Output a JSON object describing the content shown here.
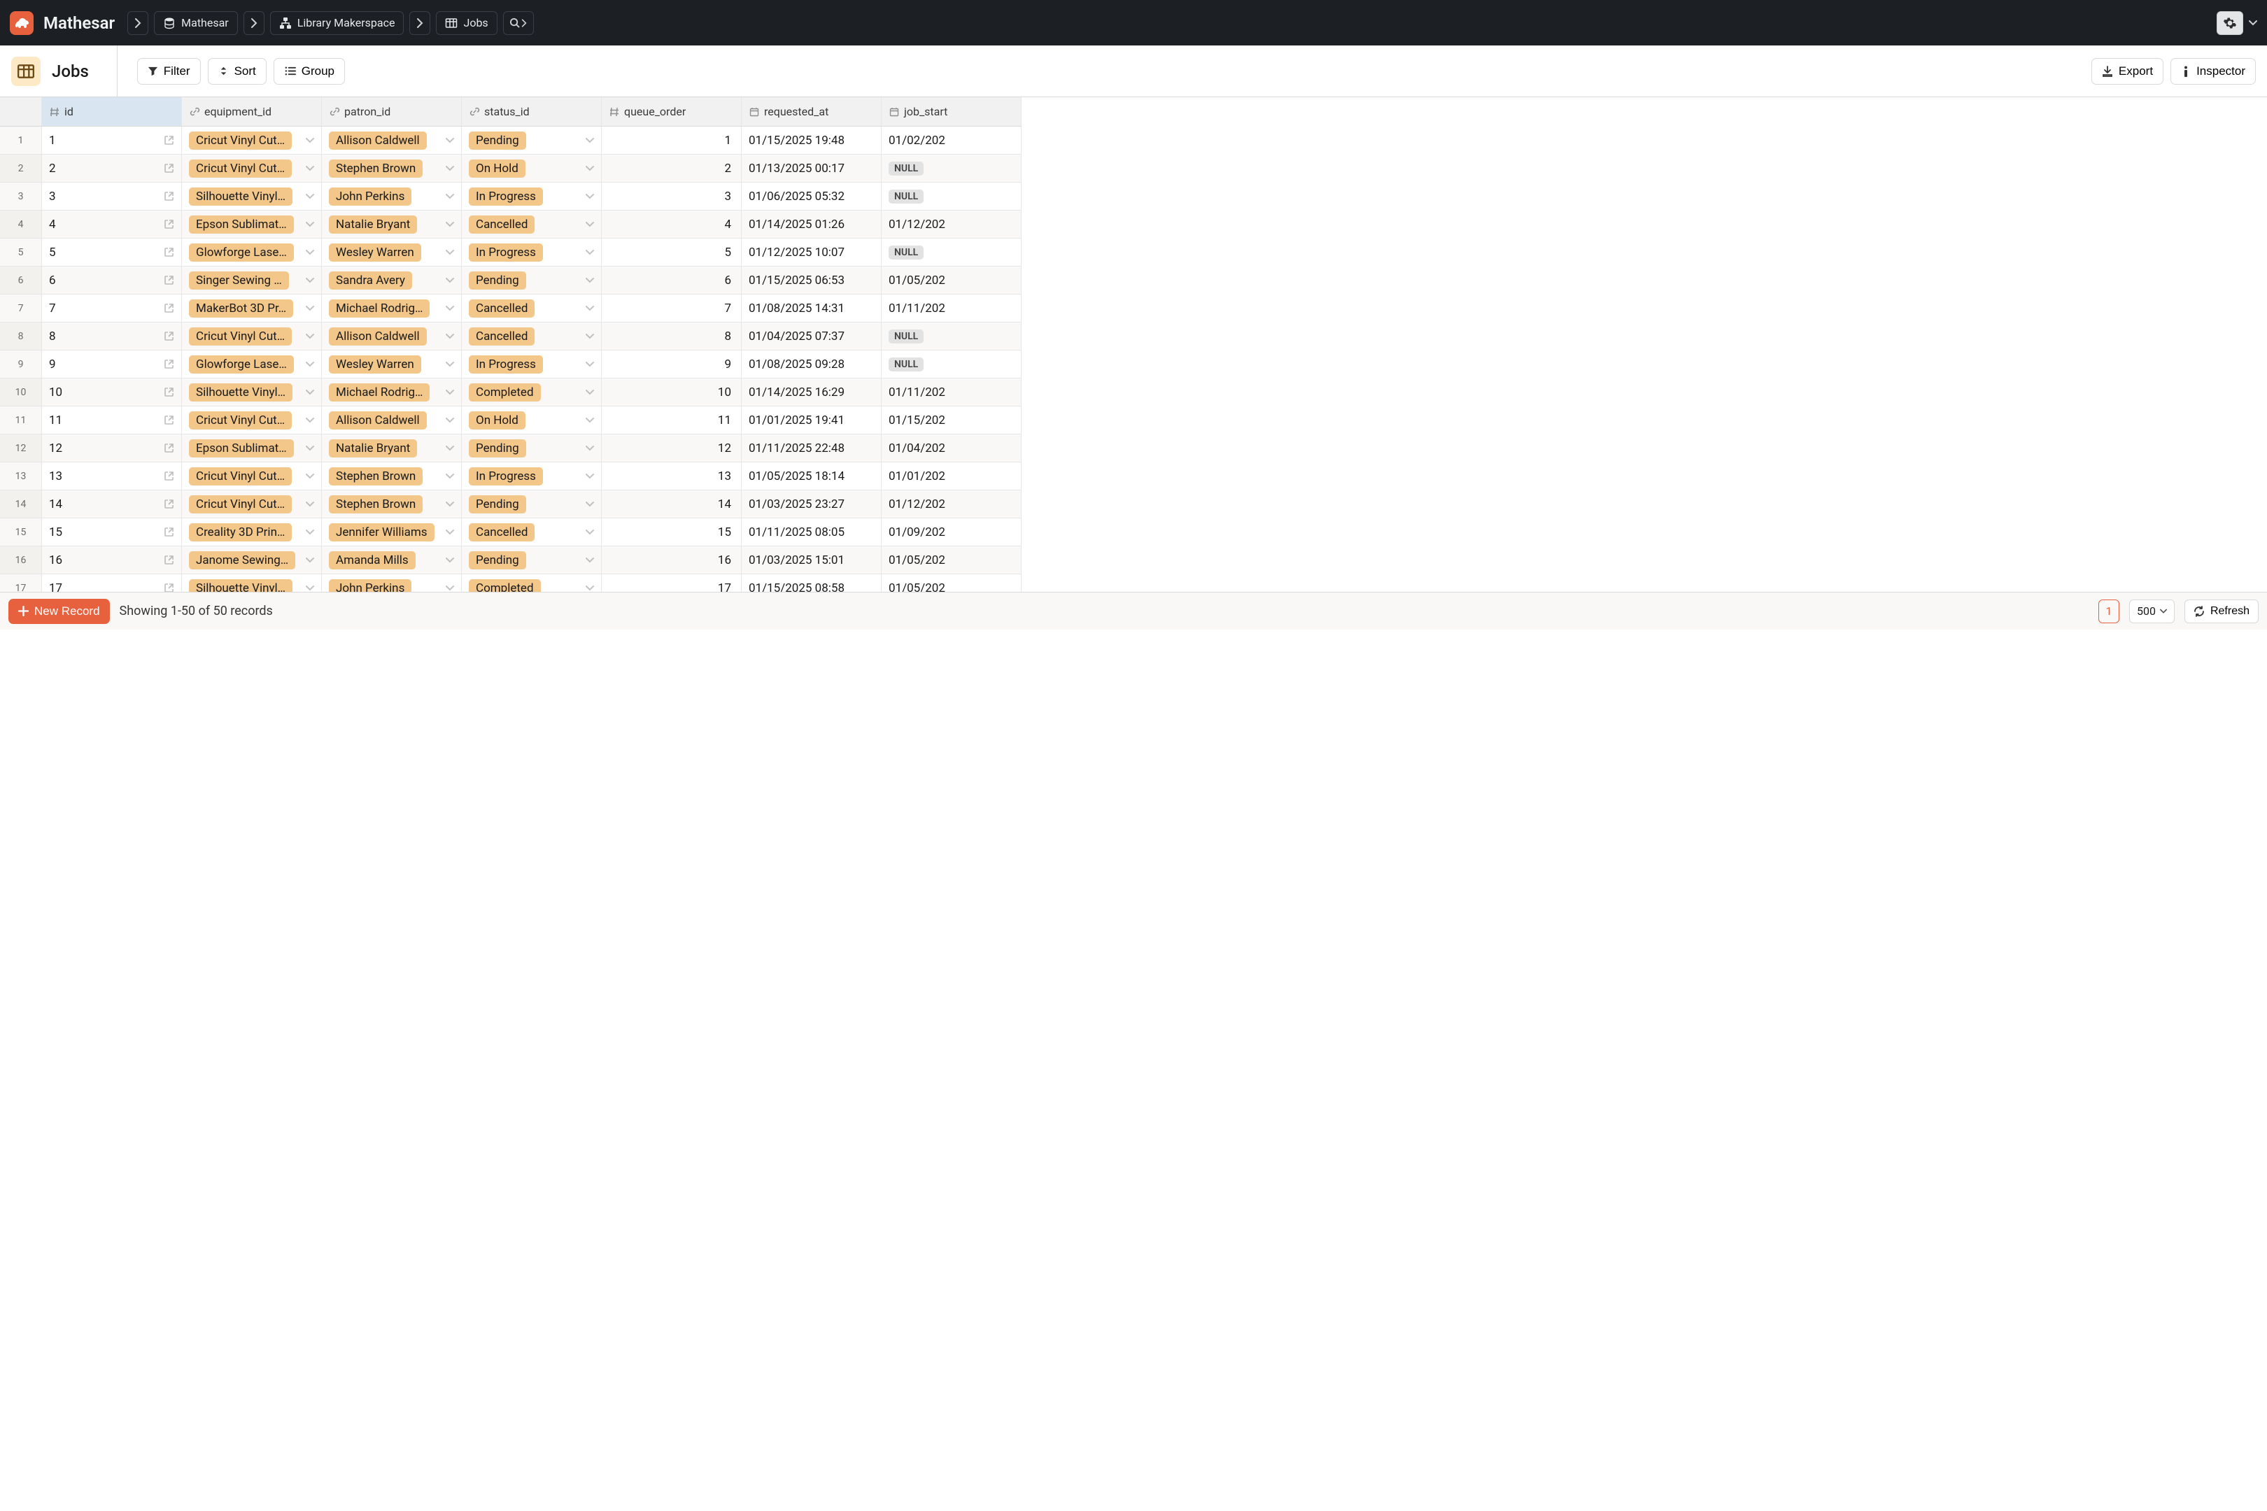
{
  "brand": "Mathesar",
  "breadcrumbs": {
    "db": "Mathesar",
    "schema": "Library Makerspace",
    "table": "Jobs"
  },
  "page": {
    "title": "Jobs"
  },
  "toolbar": {
    "filter": "Filter",
    "sort": "Sort",
    "group": "Group",
    "export": "Export",
    "inspector": "Inspector"
  },
  "columns": [
    {
      "key": "id",
      "label": "id",
      "icon": "hash",
      "selected": true
    },
    {
      "key": "equipment_id",
      "label": "equipment_id",
      "icon": "link"
    },
    {
      "key": "patron_id",
      "label": "patron_id",
      "icon": "link"
    },
    {
      "key": "status_id",
      "label": "status_id",
      "icon": "link"
    },
    {
      "key": "queue_order",
      "label": "queue_order",
      "icon": "hash"
    },
    {
      "key": "requested_at",
      "label": "requested_at",
      "icon": "cal"
    },
    {
      "key": "job_start",
      "label": "job_start",
      "icon": "cal",
      "cut": true
    }
  ],
  "rows": [
    {
      "n": 1,
      "id": "1",
      "equipment": "Cricut Vinyl Cut…",
      "patron": "Allison Caldwell",
      "status": "Pending",
      "queue": "1",
      "requested": "01/15/2025 19:48",
      "start": "01/02/202"
    },
    {
      "n": 2,
      "id": "2",
      "equipment": "Cricut Vinyl Cut…",
      "patron": "Stephen Brown",
      "status": "On Hold",
      "queue": "2",
      "requested": "01/13/2025 00:17",
      "start": null
    },
    {
      "n": 3,
      "id": "3",
      "equipment": "Silhouette Vinyl…",
      "patron": "John Perkins",
      "status": "In Progress",
      "queue": "3",
      "requested": "01/06/2025 05:32",
      "start": null
    },
    {
      "n": 4,
      "id": "4",
      "equipment": "Epson Sublimat…",
      "patron": "Natalie Bryant",
      "status": "Cancelled",
      "queue": "4",
      "requested": "01/14/2025 01:26",
      "start": "01/12/202"
    },
    {
      "n": 5,
      "id": "5",
      "equipment": "Glowforge Lase…",
      "patron": "Wesley Warren",
      "status": "In Progress",
      "queue": "5",
      "requested": "01/12/2025 10:07",
      "start": null
    },
    {
      "n": 6,
      "id": "6",
      "equipment": "Singer Sewing …",
      "patron": "Sandra Avery",
      "status": "Pending",
      "queue": "6",
      "requested": "01/15/2025 06:53",
      "start": "01/05/202"
    },
    {
      "n": 7,
      "id": "7",
      "equipment": "MakerBot 3D Pr…",
      "patron": "Michael Rodrig…",
      "status": "Cancelled",
      "queue": "7",
      "requested": "01/08/2025 14:31",
      "start": "01/11/202"
    },
    {
      "n": 8,
      "id": "8",
      "equipment": "Cricut Vinyl Cut…",
      "patron": "Allison Caldwell",
      "status": "Cancelled",
      "queue": "8",
      "requested": "01/04/2025 07:37",
      "start": null
    },
    {
      "n": 9,
      "id": "9",
      "equipment": "Glowforge Lase…",
      "patron": "Wesley Warren",
      "status": "In Progress",
      "queue": "9",
      "requested": "01/08/2025 09:28",
      "start": null
    },
    {
      "n": 10,
      "id": "10",
      "equipment": "Silhouette Vinyl…",
      "patron": "Michael Rodrig…",
      "status": "Completed",
      "queue": "10",
      "requested": "01/14/2025 16:29",
      "start": "01/11/202"
    },
    {
      "n": 11,
      "id": "11",
      "equipment": "Cricut Vinyl Cut…",
      "patron": "Allison Caldwell",
      "status": "On Hold",
      "queue": "11",
      "requested": "01/01/2025 19:41",
      "start": "01/15/202"
    },
    {
      "n": 12,
      "id": "12",
      "equipment": "Epson Sublimat…",
      "patron": "Natalie Bryant",
      "status": "Pending",
      "queue": "12",
      "requested": "01/11/2025 22:48",
      "start": "01/04/202"
    },
    {
      "n": 13,
      "id": "13",
      "equipment": "Cricut Vinyl Cut…",
      "patron": "Stephen Brown",
      "status": "In Progress",
      "queue": "13",
      "requested": "01/05/2025 18:14",
      "start": "01/01/202"
    },
    {
      "n": 14,
      "id": "14",
      "equipment": "Cricut Vinyl Cut…",
      "patron": "Stephen Brown",
      "status": "Pending",
      "queue": "14",
      "requested": "01/03/2025 23:27",
      "start": "01/12/202"
    },
    {
      "n": 15,
      "id": "15",
      "equipment": "Creality 3D Prin…",
      "patron": "Jennifer Williams",
      "status": "Cancelled",
      "queue": "15",
      "requested": "01/11/2025 08:05",
      "start": "01/09/202"
    },
    {
      "n": 16,
      "id": "16",
      "equipment": "Janome Sewing…",
      "patron": "Amanda Mills",
      "status": "Pending",
      "queue": "16",
      "requested": "01/03/2025 15:01",
      "start": "01/05/202"
    },
    {
      "n": 17,
      "id": "17",
      "equipment": "Silhouette Vinyl…",
      "patron": "John Perkins",
      "status": "Completed",
      "queue": "17",
      "requested": "01/15/2025 08:58",
      "start": "01/05/202"
    }
  ],
  "footer": {
    "new_record": "New Record",
    "showing": "Showing 1-50 of 50 records",
    "page": "1",
    "page_size": "500",
    "refresh": "Refresh"
  },
  "null_label": "NULL"
}
